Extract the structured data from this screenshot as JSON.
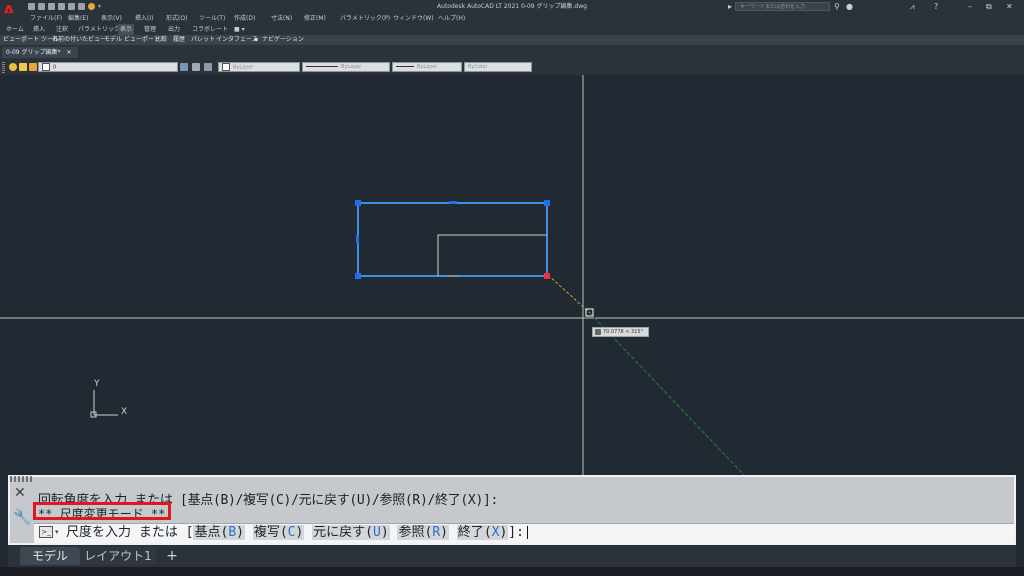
{
  "app": {
    "title": "Autodesk AutoCAD LT 2021    0-09 グリップ編集.dwg",
    "logo": "A",
    "search_placeholder": "キーワードまたは語句を入力",
    "window_controls": [
      "–",
      "⧉",
      "✕"
    ]
  },
  "menu": [
    "ファイル(F)",
    "編集(E)",
    "表示(V)",
    "挿入(I)",
    "形式(O)",
    "ツール(T)",
    "作成(D)",
    "寸法(N)",
    "修正(M)",
    "パラメトリック(P)",
    "ウィンドウ(W)",
    "ヘルプ(H)"
  ],
  "ribbon_tabs": [
    "ホーム",
    "挿入",
    "注釈",
    "パラメトリック",
    "表示",
    "管理",
    "出力",
    "コラボレート",
    "■ ▾"
  ],
  "ribbon_active_tab": "表示",
  "panels": [
    "ビューポート ツール",
    "名前の付いたビュー",
    "モデル ビューポート",
    "比較",
    "履歴",
    "パレット",
    "インタフェース",
    "ナビゲーション"
  ],
  "file_tab": "0-09 グリップ編集*",
  "properties": {
    "layer": "0",
    "color": "ByLayer",
    "linetype": "ByLayer",
    "lineweight": "ByLayer",
    "plotstyle": "ByColor"
  },
  "tooltip": "70.0778 < 315°",
  "ucs": {
    "y_label": "Y",
    "x_label": "X"
  },
  "command": {
    "history_line1": "回転角度を入力 または [基点(B)/複写(C)/元に戻す(U)/参照(R)/終了(X)]:",
    "history_line2": "** 尺度変更モード **",
    "prompt_prefix": "尺度を入力 または [",
    "options": [
      {
        "text": "基点",
        "key": "B"
      },
      {
        "text": "複写",
        "key": "C"
      },
      {
        "text": "元に戻す",
        "key": "U"
      },
      {
        "text": "参照",
        "key": "R"
      },
      {
        "text": "終了",
        "key": "X"
      }
    ],
    "prompt_suffix": "]:",
    "close_icon": "close-icon",
    "settings_icon": "wrench-icon"
  },
  "layout_tabs": {
    "model": "モデル",
    "layout1": "レイアウト1",
    "add": "+"
  },
  "colors": {
    "background": "#212a33",
    "selection": "#3f8fe0",
    "grip": "#1e6fe8",
    "hot_grip": "#e8343a",
    "highlight_box": "#e2161c"
  }
}
